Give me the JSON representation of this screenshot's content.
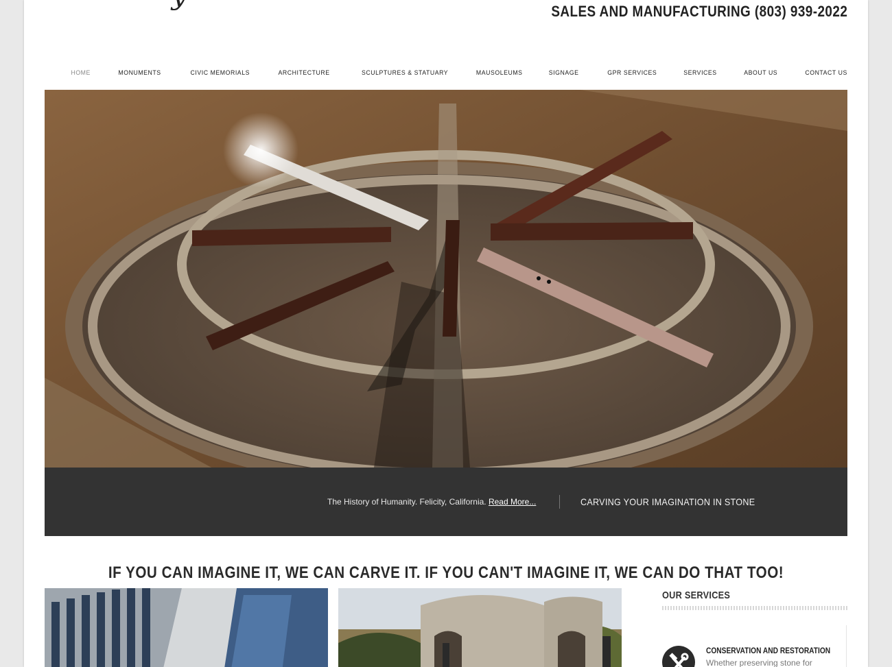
{
  "header": {
    "logo_text": "y",
    "phone_line": "SALES AND MANUFACTURING (803) 939-2022"
  },
  "nav": {
    "items": [
      {
        "label": "HOME"
      },
      {
        "label": "MONUMENTS"
      },
      {
        "label": "CIVIC MEMORIALS"
      },
      {
        "label": "ARCHITECTURE"
      },
      {
        "label": "SCULPTURES & STATUARY"
      },
      {
        "label": "MAUSOLEUMS"
      },
      {
        "label": "SIGNAGE"
      },
      {
        "label": "GPR SERVICES"
      },
      {
        "label": "SERVICES"
      },
      {
        "label": "ABOUT US"
      },
      {
        "label": "CONTACT US"
      }
    ],
    "active_index": 0
  },
  "slider": {
    "caption": "The History of Humanity.  Felicity, California. ",
    "read_more": "Read More...",
    "tagline": "CARVING YOUR IMAGINATION IN STONE"
  },
  "main": {
    "headline": "IF YOU CAN IMAGINE IT, WE CAN CARVE IT. IF YOU CAN'T IMAGINE IT, WE CAN DO THAT TOO!"
  },
  "services": {
    "title": "OUR SERVICES",
    "items": [
      {
        "name": "CONSERVATION AND RESTORATION",
        "description": "Whether preserving stone for",
        "icon": "hammer-wrench-icon"
      }
    ]
  },
  "colors": {
    "caption_bar": "#333333",
    "page_background": "#e9e9e9",
    "text_dark": "#222222"
  }
}
